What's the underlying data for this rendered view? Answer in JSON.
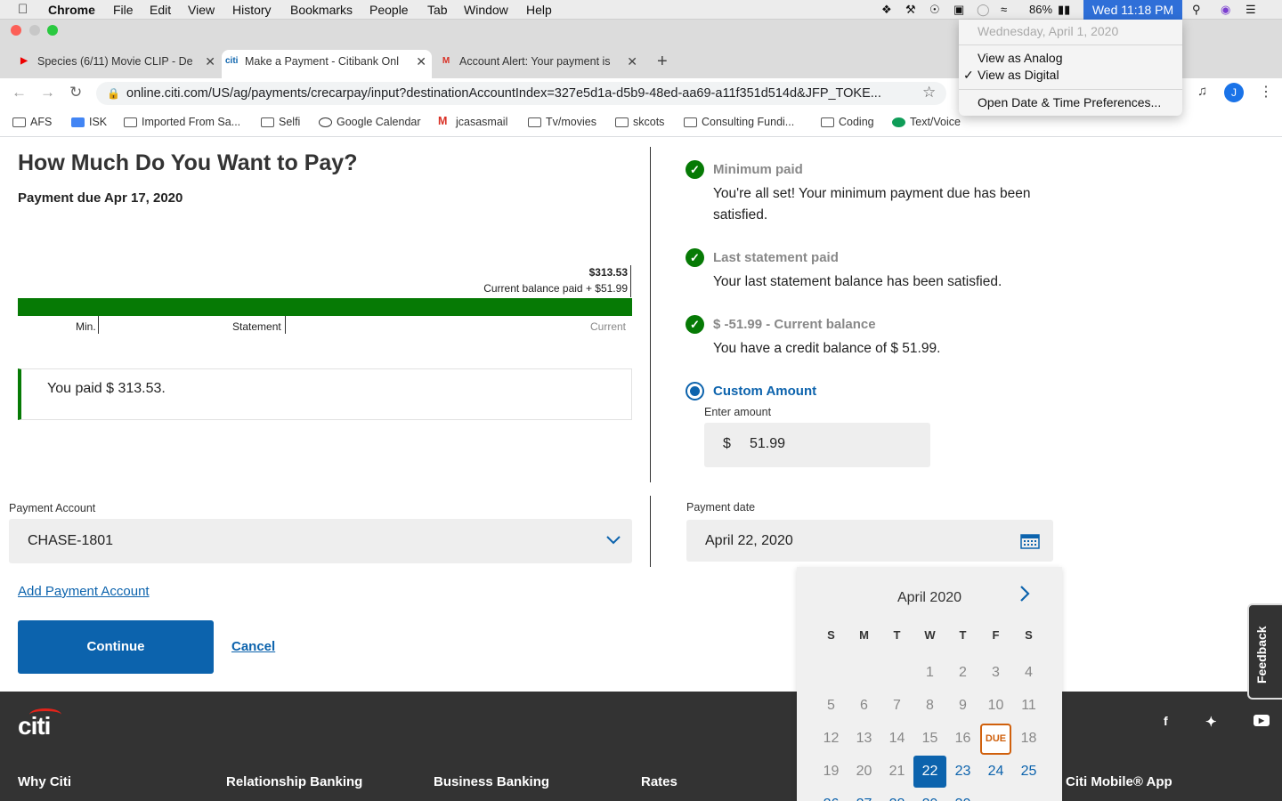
{
  "menubar": {
    "app": "Chrome",
    "items": [
      "File",
      "Edit",
      "View",
      "History",
      "Bookmarks",
      "People",
      "Tab",
      "Window",
      "Help"
    ],
    "battery": "86%",
    "clock": "Wed 11:18 PM"
  },
  "clock_menu": {
    "date": "Wednesday, April 1, 2020",
    "items": [
      "View as Analog",
      "View as Digital",
      "Open Date & Time Preferences..."
    ],
    "checked": "View as Digital"
  },
  "tabs": [
    {
      "title": "Species (6/11) Movie CLIP - De",
      "icon": "youtube-icon"
    },
    {
      "title": "Make a Payment - Citibank Onl",
      "icon": "citi-icon",
      "active": true
    },
    {
      "title": "Account Alert: Your payment is",
      "icon": "gmail-icon"
    }
  ],
  "url": "online.citi.com/US/ag/payments/crecarpay/input?destinationAccountIndex=327e5d1a-d5b9-48ed-aa69-a11f351d514d&JFP_TOKE...",
  "profile_initial": "J",
  "bookmarks": [
    "AFS",
    "ISK",
    "Imported From Sa...",
    "Selfi",
    "Google Calendar",
    "jcasasmail",
    "Tv/movies",
    "skcots",
    "Consulting Fundi...",
    "Coding",
    "Text/Voice"
  ],
  "page": {
    "title": "How Much Do You Want to Pay?",
    "due": "Payment due Apr 17, 2020",
    "bar": {
      "amount": "$313.53",
      "subtitle": "Current balance paid + $51.99",
      "labels": [
        "Min.",
        "Statement",
        "Current"
      ],
      "fill_fraction": 1.0
    },
    "paid_message": "You paid $ 313.53.",
    "statuses": [
      {
        "title": "Minimum paid",
        "body": "You're all set! Your minimum payment due has been satisfied."
      },
      {
        "title": "Last statement paid",
        "body": "Your last statement balance has been satisfied."
      },
      {
        "title": "$ -51.99 - Current balance",
        "body": "You have a credit balance of $ 51.99."
      }
    ],
    "custom_amount": {
      "label": "Custom Amount",
      "field_label": "Enter amount",
      "currency": "$",
      "value": "51.99"
    },
    "payment_account": {
      "label": "Payment Account",
      "value": "CHASE-1801"
    },
    "payment_date": {
      "label": "Payment date",
      "value": "April 22, 2020"
    },
    "add_account": "Add Payment Account",
    "continue": "Continue",
    "cancel": "Cancel"
  },
  "calendar": {
    "month": "April 2020",
    "weekdays": [
      "S",
      "M",
      "T",
      "W",
      "T",
      "F",
      "S"
    ],
    "due_label": "DUE",
    "selected": "22"
  },
  "footer": {
    "logo": "citi",
    "columns": [
      "Why Citi",
      "Relationship Banking",
      "Business Banking",
      "Rates"
    ],
    "mobile_app": "Citi Mobile® App"
  },
  "feedback": "Feedback",
  "colors": {
    "brand_blue": "#0c63ad",
    "success_green": "#067a05",
    "due_orange": "#d0600c",
    "footer_bg": "#333333"
  }
}
